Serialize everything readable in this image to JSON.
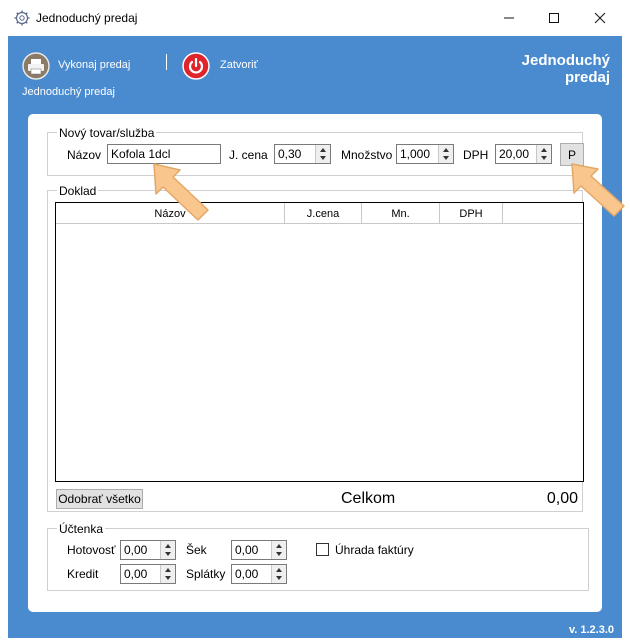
{
  "window": {
    "title": "Jednoduchý predaj",
    "minimize_icon": "minimize-icon",
    "maximize_icon": "maximize-icon",
    "close_icon": "close-icon"
  },
  "toolbar": {
    "execute_label": "Vykonaj predaj",
    "close_label": "Zatvoriť",
    "section_label": "Jednoduchý predaj",
    "header_title_line1": "Jednoduchý",
    "header_title_line2": "predaj"
  },
  "new_item": {
    "legend": "Nový tovar/služba",
    "name_label": "Názov",
    "name_value": "Kofola 1dcl",
    "price_label": "J. cena",
    "price_value": "0,30",
    "qty_label": "Množstvo",
    "qty_value": "1,000",
    "vat_label": "DPH",
    "vat_value": "20,00",
    "add_button": "P"
  },
  "receipt": {
    "legend": "Doklad",
    "columns": [
      "Názov",
      "J.cena",
      "Mn.",
      "DPH",
      ""
    ],
    "rows": [],
    "remove_all_button": "Odobrať všetko",
    "total_label": "Celkom",
    "total_value": "0,00"
  },
  "bill": {
    "legend": "Účtenka",
    "cash_label": "Hotovosť",
    "cash_value": "0,00",
    "check_label": "Šek",
    "check_value": "0,00",
    "credit_label": "Kredit",
    "credit_value": "0,00",
    "installments_label": "Splátky",
    "installments_value": "0,00",
    "invoice_label": "Úhrada faktúry",
    "invoice_checked": false
  },
  "footer": {
    "version": "v. 1.2.3.0"
  },
  "colors": {
    "accent_blue": "#4a8bd0",
    "power_red": "#e0242b",
    "highlight_arrow": "#f9c68e"
  }
}
